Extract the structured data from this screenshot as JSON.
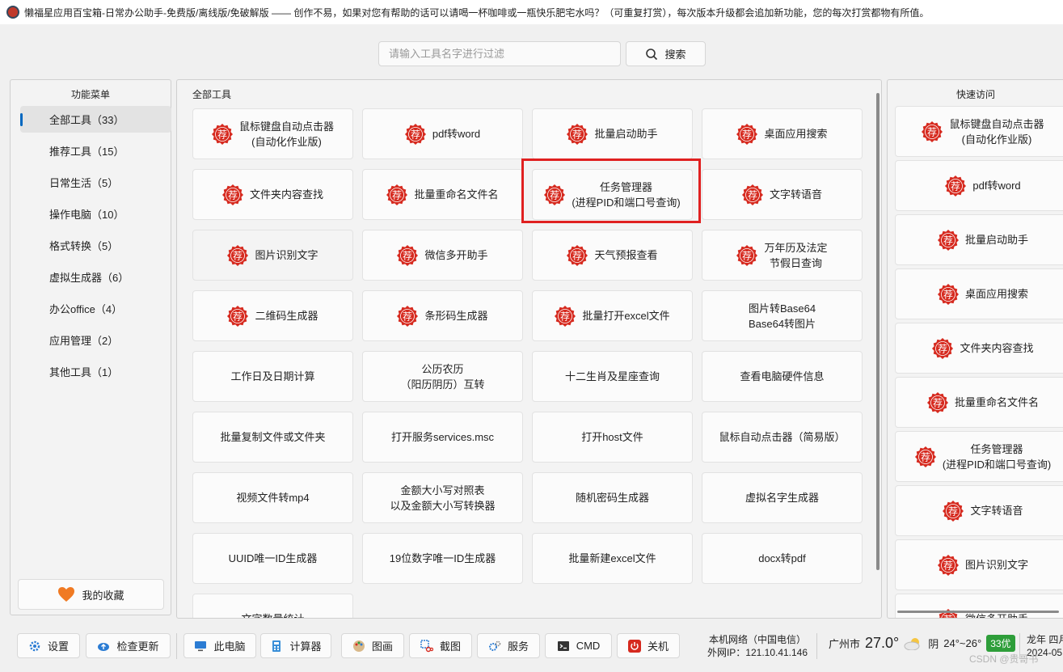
{
  "window": {
    "title": "懒福星应用百宝箱-日常办公助手-免费版/离线版/免破解版 —— 创作不易，如果对您有帮助的话可以请喝一杯咖啡或一瓶快乐肥宅水吗？（可重复打赏），每次版本升级都会追加新功能，您的每次打赏都物有所值。"
  },
  "search": {
    "placeholder": "请输入工具名字进行过滤",
    "button_label": "搜索",
    "icon": "search-icon"
  },
  "sidebar": {
    "title": "功能菜单",
    "items": [
      {
        "label": "全部工具（33）",
        "active": true
      },
      {
        "label": "推荐工具（15）"
      },
      {
        "label": "日常生活（5）"
      },
      {
        "label": "操作电脑（10）"
      },
      {
        "label": "格式转换（5）"
      },
      {
        "label": "虚拟生成器（6）"
      },
      {
        "label": "办公office（4）"
      },
      {
        "label": "应用管理（2）"
      },
      {
        "label": "其他工具（1）"
      }
    ],
    "favorites_label": "我的收藏",
    "favorites_icon": "heart-icon"
  },
  "tools": {
    "title": "全部工具",
    "badge_text": "荐",
    "items": [
      {
        "label": "鼠标键盘自动点击器\n(自动化作业版)",
        "badge": true
      },
      {
        "label": "pdf转word",
        "badge": true
      },
      {
        "label": "批量启动助手",
        "badge": true
      },
      {
        "label": "桌面应用搜索",
        "badge": true
      },
      {
        "label": "文件夹内容查找",
        "badge": true
      },
      {
        "label": "批量重命名文件名",
        "badge": true
      },
      {
        "label": "任务管理器\n(进程PID和端口号查询)",
        "badge": true
      },
      {
        "label": "文字转语音",
        "badge": true
      },
      {
        "label": "图片识别文字",
        "badge": true
      },
      {
        "label": "微信多开助手",
        "badge": true
      },
      {
        "label": "天气预报查看",
        "badge": true
      },
      {
        "label": "万年历及法定\n节假日查询",
        "badge": true
      },
      {
        "label": "二维码生成器",
        "badge": true
      },
      {
        "label": "条形码生成器",
        "badge": true
      },
      {
        "label": "批量打开excel文件",
        "badge": true
      },
      {
        "label": "图片转Base64\nBase64转图片",
        "badge": false
      },
      {
        "label": "工作日及日期计算",
        "badge": false
      },
      {
        "label": "公历农历\n（阳历阴历）互转",
        "badge": false
      },
      {
        "label": "十二生肖及星座查询",
        "badge": false
      },
      {
        "label": "查看电脑硬件信息",
        "badge": false
      },
      {
        "label": "批量复制文件或文件夹",
        "badge": false
      },
      {
        "label": "打开服务services.msc",
        "badge": false
      },
      {
        "label": "打开host文件",
        "badge": false
      },
      {
        "label": "鼠标自动点击器（简易版）",
        "badge": false
      },
      {
        "label": "视频文件转mp4",
        "badge": false
      },
      {
        "label": "金额大小写对照表\n以及金额大小写转换器",
        "badge": false
      },
      {
        "label": "随机密码生成器",
        "badge": false
      },
      {
        "label": "虚拟名字生成器",
        "badge": false
      },
      {
        "label": "UUID唯一ID生成器",
        "badge": false
      },
      {
        "label": "19位数字唯一ID生成器",
        "badge": false
      },
      {
        "label": "批量新建excel文件",
        "badge": false
      },
      {
        "label": "docx转pdf",
        "badge": false
      },
      {
        "label": "文字数量统计",
        "badge": false
      }
    ]
  },
  "quick_access": {
    "title": "快速访问",
    "items": [
      {
        "label": "鼠标键盘自动点击器\n(自动化作业版)"
      },
      {
        "label": "pdf转word"
      },
      {
        "label": "批量启动助手"
      },
      {
        "label": "桌面应用搜索"
      },
      {
        "label": "文件夹内容查找"
      },
      {
        "label": "批量重命名文件名"
      },
      {
        "label": "任务管理器\n(进程PID和端口号查询)"
      },
      {
        "label": "文字转语音"
      },
      {
        "label": "图片识别文字"
      },
      {
        "label": "微信多开助手"
      }
    ]
  },
  "bottombar": {
    "buttons": [
      {
        "label": "设置",
        "icon": "gear-icon"
      },
      {
        "label": "检查更新",
        "icon": "cloud-icon"
      },
      {
        "label": "此电脑",
        "icon": "monitor-icon"
      },
      {
        "label": "计算器",
        "icon": "calculator-icon"
      },
      {
        "label": "图画",
        "icon": "palette-icon"
      },
      {
        "label": "截图",
        "icon": "scissors-icon"
      },
      {
        "label": "服务",
        "icon": "gears-icon"
      },
      {
        "label": "CMD",
        "icon": "terminal-icon"
      },
      {
        "label": "关机",
        "icon": "power-icon"
      }
    ],
    "network": {
      "line1": "本机网络（中国电信）",
      "line2": "外网IP：121.10.41.146"
    },
    "weather": {
      "city": "广州市",
      "temp": "27.0°",
      "condition": "阴",
      "range": "24°~26°",
      "aqi": "33优"
    },
    "date": {
      "line1": "龙年 四月",
      "line2": "2024-05"
    },
    "watermark": "CSDN @贵哥书"
  },
  "colors": {
    "accent": "#0067c0",
    "badge_red": "#d62a1f",
    "highlight_box": "#e02020",
    "aqi_green": "#2e9e3a"
  }
}
